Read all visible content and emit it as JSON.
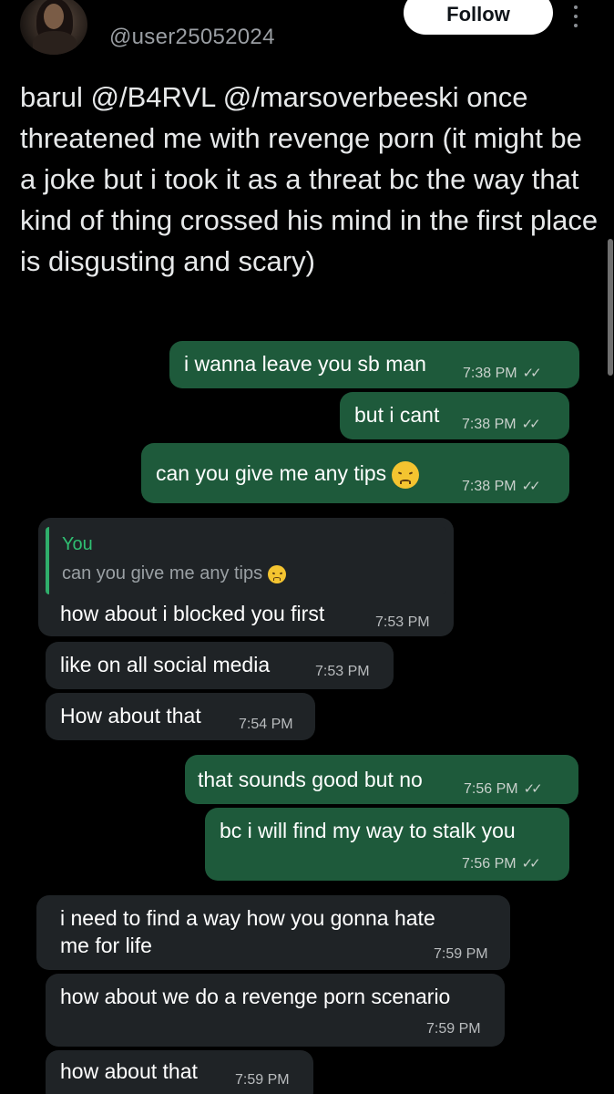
{
  "header": {
    "handle": "@user25052024",
    "follow_label": "Follow"
  },
  "tweet": {
    "text": "barul @/B4RVL @/marsoverbeeski once threatened me with revenge porn (it might be a joke but i took it as a threat bc the way that kind of thing crossed his mind in the first place is disgusting and scary)"
  },
  "chat": {
    "messages": [
      {
        "dir": "out",
        "text": "i wanna leave you sb man",
        "time": "7:38 PM"
      },
      {
        "dir": "out",
        "text": "but i cant",
        "time": "7:38 PM"
      },
      {
        "dir": "out",
        "text": "can you give me any tips",
        "time": "7:38 PM",
        "emoji": "disappointed-face"
      },
      {
        "dir": "in",
        "quote_author": "You",
        "quote_text": "can you give me any tips",
        "text": "how about i blocked you first",
        "time": "7:53 PM"
      },
      {
        "dir": "in",
        "text": "like on all social media",
        "time": "7:53 PM"
      },
      {
        "dir": "in",
        "text": "How about that",
        "time": "7:54 PM"
      },
      {
        "dir": "out",
        "text": "that sounds good but no",
        "time": "7:56 PM"
      },
      {
        "dir": "out",
        "text": "bc i will find my way to stalk you",
        "time": "7:56 PM"
      },
      {
        "dir": "in",
        "text_line1": "i need to find a way how you gonna hate",
        "text_line2": "me for life",
        "time": "7:59 PM"
      },
      {
        "dir": "in",
        "text": "how about we do a revenge porn scenario",
        "time": "7:59 PM"
      },
      {
        "dir": "in",
        "text": "how about that",
        "time": "7:59 PM"
      }
    ]
  },
  "colors": {
    "outgoing_bubble": "#1e5a3b",
    "incoming_bubble": "#1f2326",
    "quote_accent": "#2fae6b"
  }
}
